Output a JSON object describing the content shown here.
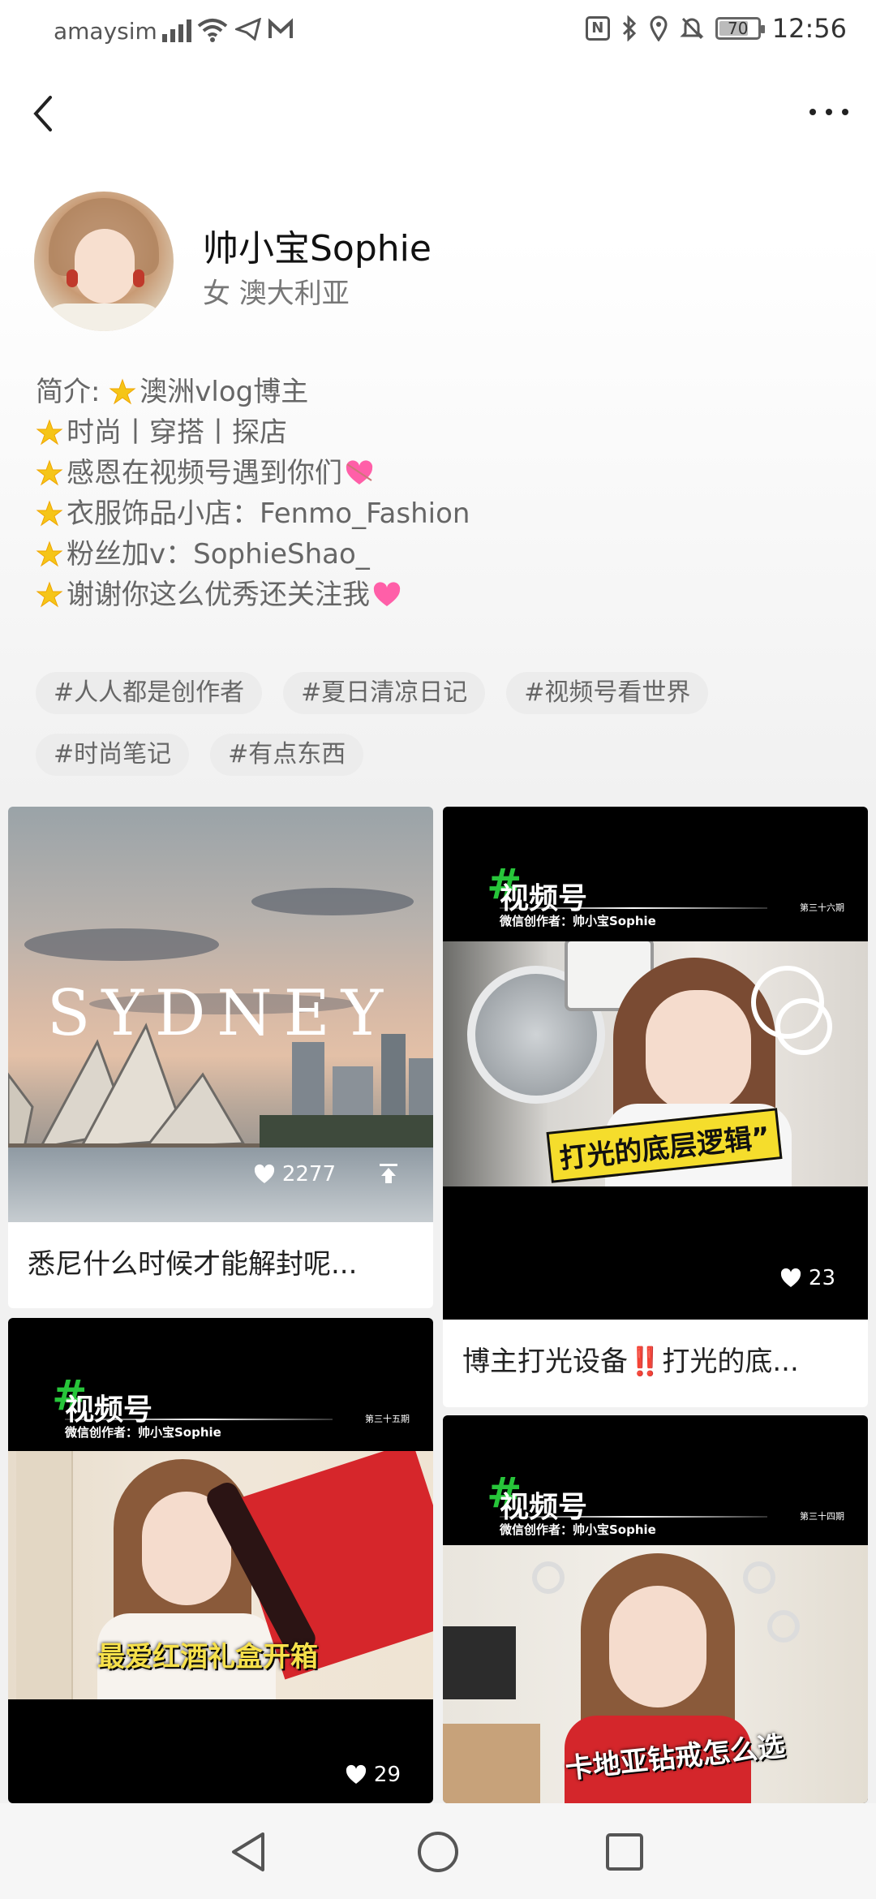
{
  "status_bar": {
    "carrier": "amaysim",
    "battery": "70",
    "time": "12:56"
  },
  "nav": {
    "back_icon": "chevron-left-icon",
    "more_icon": "more-horizontal-icon"
  },
  "profile": {
    "name": "帅小宝Sophie",
    "subtitle": "女 澳大利亚",
    "bio": [
      "简介: ",
      "澳洲vlog博主",
      "时尚丨穿搭丨探店",
      "感恩在视频号遇到你们",
      "衣服饰品小店：Fenmo_Fashion",
      "粉丝加v：SophieShao_",
      "谢谢你这么优秀还关注我"
    ]
  },
  "tags": [
    "#人人都是创作者",
    "#夏日清凉日记",
    "#视频号看世界",
    "#时尚笔记",
    "#有点东西"
  ],
  "feed": [
    {
      "overlay_text": "SYDNEY",
      "likes": "2277",
      "caption": "悉尼什么时候才能解封呢..."
    },
    {
      "channel_title": "视频号",
      "channel_author": "微信创作者：帅小宝Sophie",
      "episode": "第三十六期",
      "banner": "打光的底层逻辑”",
      "likes": "23",
      "caption": "博主打光设备‼️打光的底..."
    },
    {
      "channel_title": "视频号",
      "channel_author": "微信创作者：帅小宝Sophie",
      "episode": "第三十五期",
      "banner": "最爱红酒礼盒开箱",
      "likes": "29"
    },
    {
      "channel_title": "视频号",
      "channel_author": "微信创作者：帅小宝Sophie",
      "episode": "第三十四期",
      "banner": "卡地亚钻戒怎么选"
    }
  ],
  "colors": {
    "channel_hash": "#27c53a",
    "heart_pink": "#ff5fa8",
    "star_gold": "#f5c518"
  }
}
